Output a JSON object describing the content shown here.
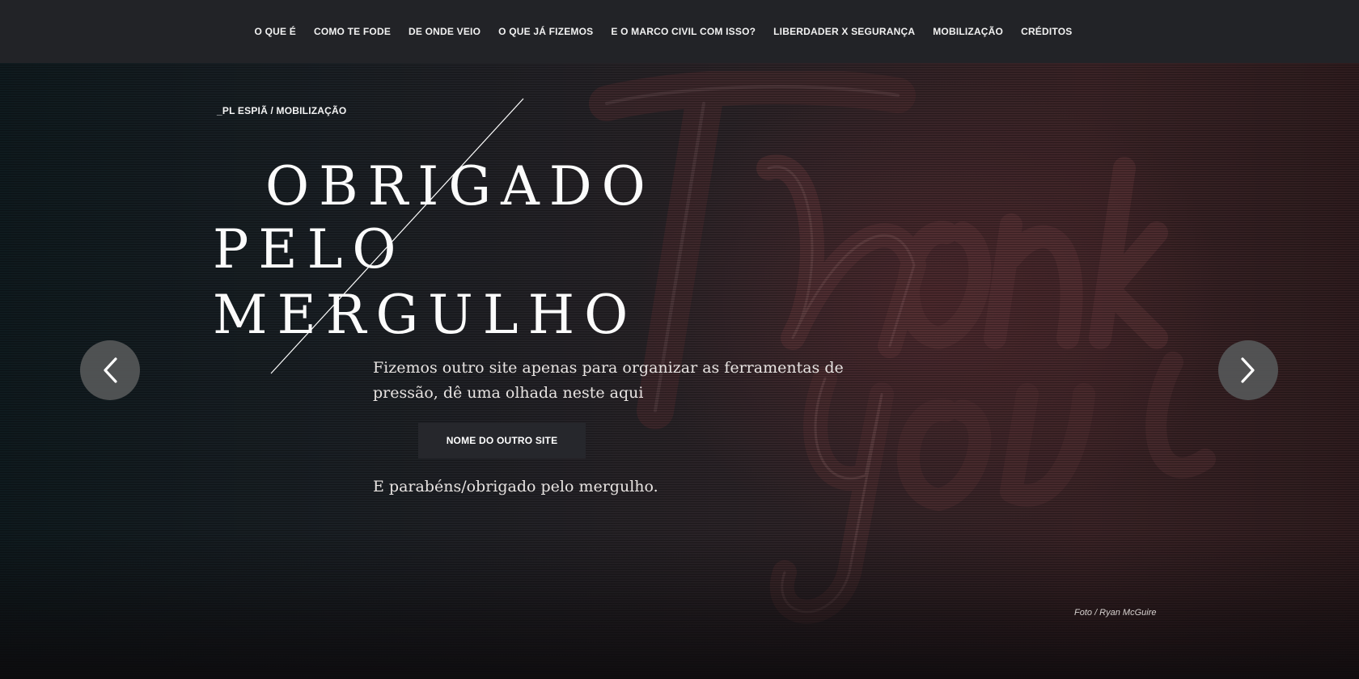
{
  "nav": {
    "items": [
      "O QUE É",
      "COMO TE FODE",
      "DE ONDE VEIO",
      "O QUE JÁ FIZEMOS",
      "E O MARCO CIVIL COM ISSO?",
      "LIBERDADER X SEGURANÇA",
      "MOBILIZAÇÃO",
      "CRÉDITOS"
    ]
  },
  "hero": {
    "breadcrumb": "_PL ESPIÃ / MOBILIZAÇÃO",
    "title_lines": [
      "OBRIGADO",
      "PELO",
      "MERGULHO"
    ],
    "description": "Fizemos outro site apenas para organizar as ferramentas de pressão, dê uma olhada neste aqui",
    "button_label": "NOME DO OUTRO SITE",
    "thanks_text": "E parabéns/obrigado pelo mergulho.",
    "photo_credit": "Foto / Ryan McGuire"
  },
  "icons": {
    "prev": "chevron-left-icon",
    "next": "chevron-right-icon"
  },
  "colors": {
    "nav_bg": "#222327",
    "button_bg": "#26272c",
    "arrow_bg": "#555758"
  }
}
